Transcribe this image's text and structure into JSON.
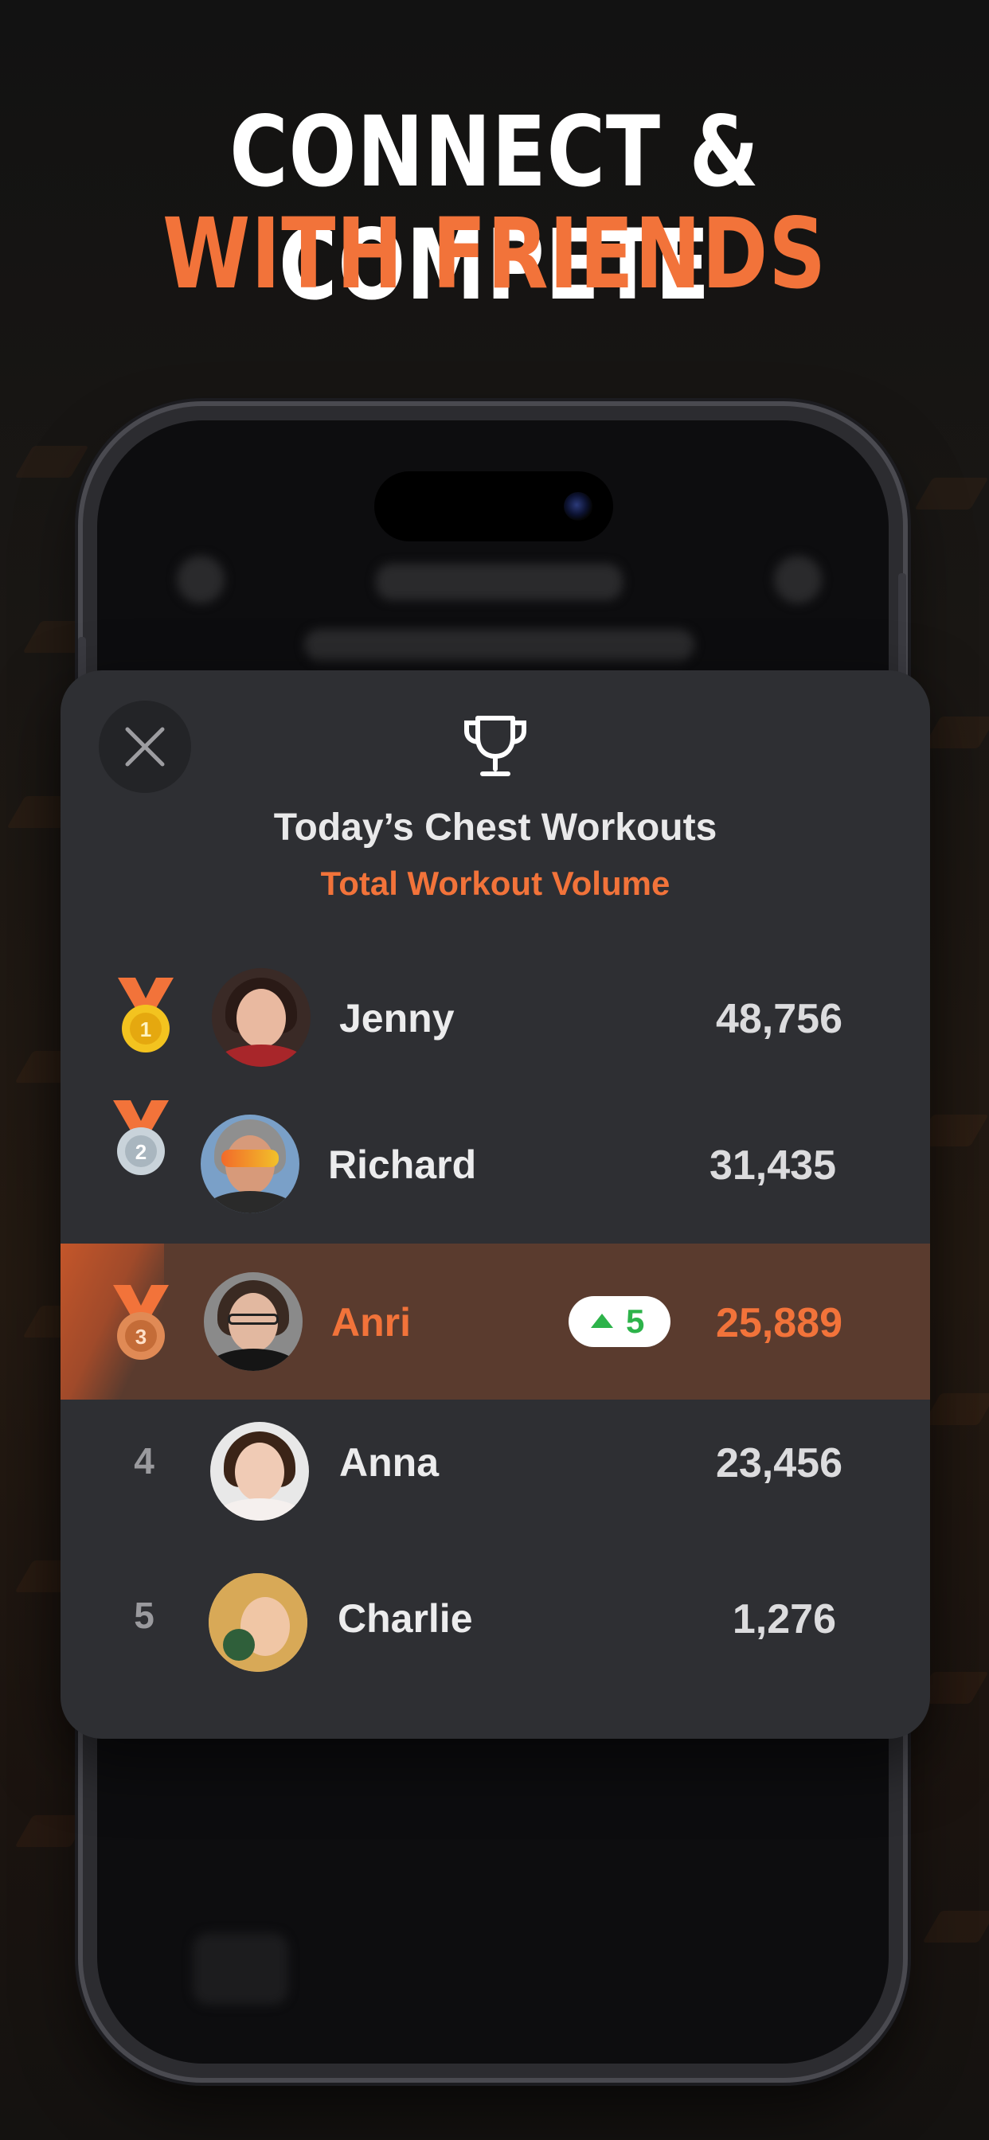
{
  "headline": {
    "line1": "CONNECT & COMPETE",
    "line2": "WITH FRIENDS"
  },
  "colors": {
    "accent": "#f2733a",
    "card": "#2e2f33",
    "highlight_row": "#5a3b2e",
    "rank_up": "#2db34a"
  },
  "modal": {
    "close_icon": "close-icon",
    "trophy_icon": "trophy-icon",
    "title": "Today’s Chest Workouts",
    "subtitle": "Total Workout Volume"
  },
  "leaderboard": [
    {
      "rank": "1",
      "medal": "gold-medal-icon",
      "name": "Jenny",
      "score": "48,756"
    },
    {
      "rank": "2",
      "medal": "silver-medal-icon",
      "name": "Richard",
      "score": "31,435"
    },
    {
      "rank": "3",
      "medal": "bronze-medal-icon",
      "name": "Anri",
      "score": "25,889",
      "change": "5",
      "highlighted": true
    },
    {
      "rank": "4",
      "name": "Anna",
      "score": "23,456"
    },
    {
      "rank": "5",
      "name": "Charlie",
      "score": "1,276"
    }
  ]
}
